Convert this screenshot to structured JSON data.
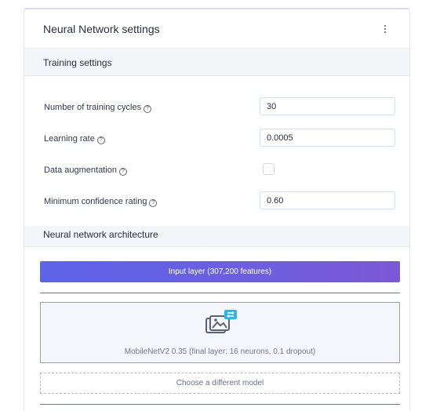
{
  "header": {
    "title": "Neural Network settings"
  },
  "training": {
    "section_title": "Training settings",
    "cycles": {
      "label": "Number of training cycles",
      "value": "30"
    },
    "learning_rate": {
      "label": "Learning rate",
      "value": "0.0005"
    },
    "augmentation": {
      "label": "Data augmentation",
      "checked": false
    },
    "confidence": {
      "label": "Minimum confidence rating",
      "value": "0.60"
    }
  },
  "architecture": {
    "section_title": "Neural network architecture",
    "input_layer": "Input layer (307,200 features)",
    "model_name": "MobileNetV2 0.35 (final layer: 16 neurons, 0.1 dropout)",
    "choose_label": "Choose a different model"
  },
  "icons": {
    "help": "?",
    "kebab": "kebab-menu-icon",
    "model": "image-model-icon"
  },
  "colors": {
    "accent_start": "#5d64e8",
    "accent_end": "#7d58d6",
    "model_icon_accent": "#29b6e8"
  }
}
